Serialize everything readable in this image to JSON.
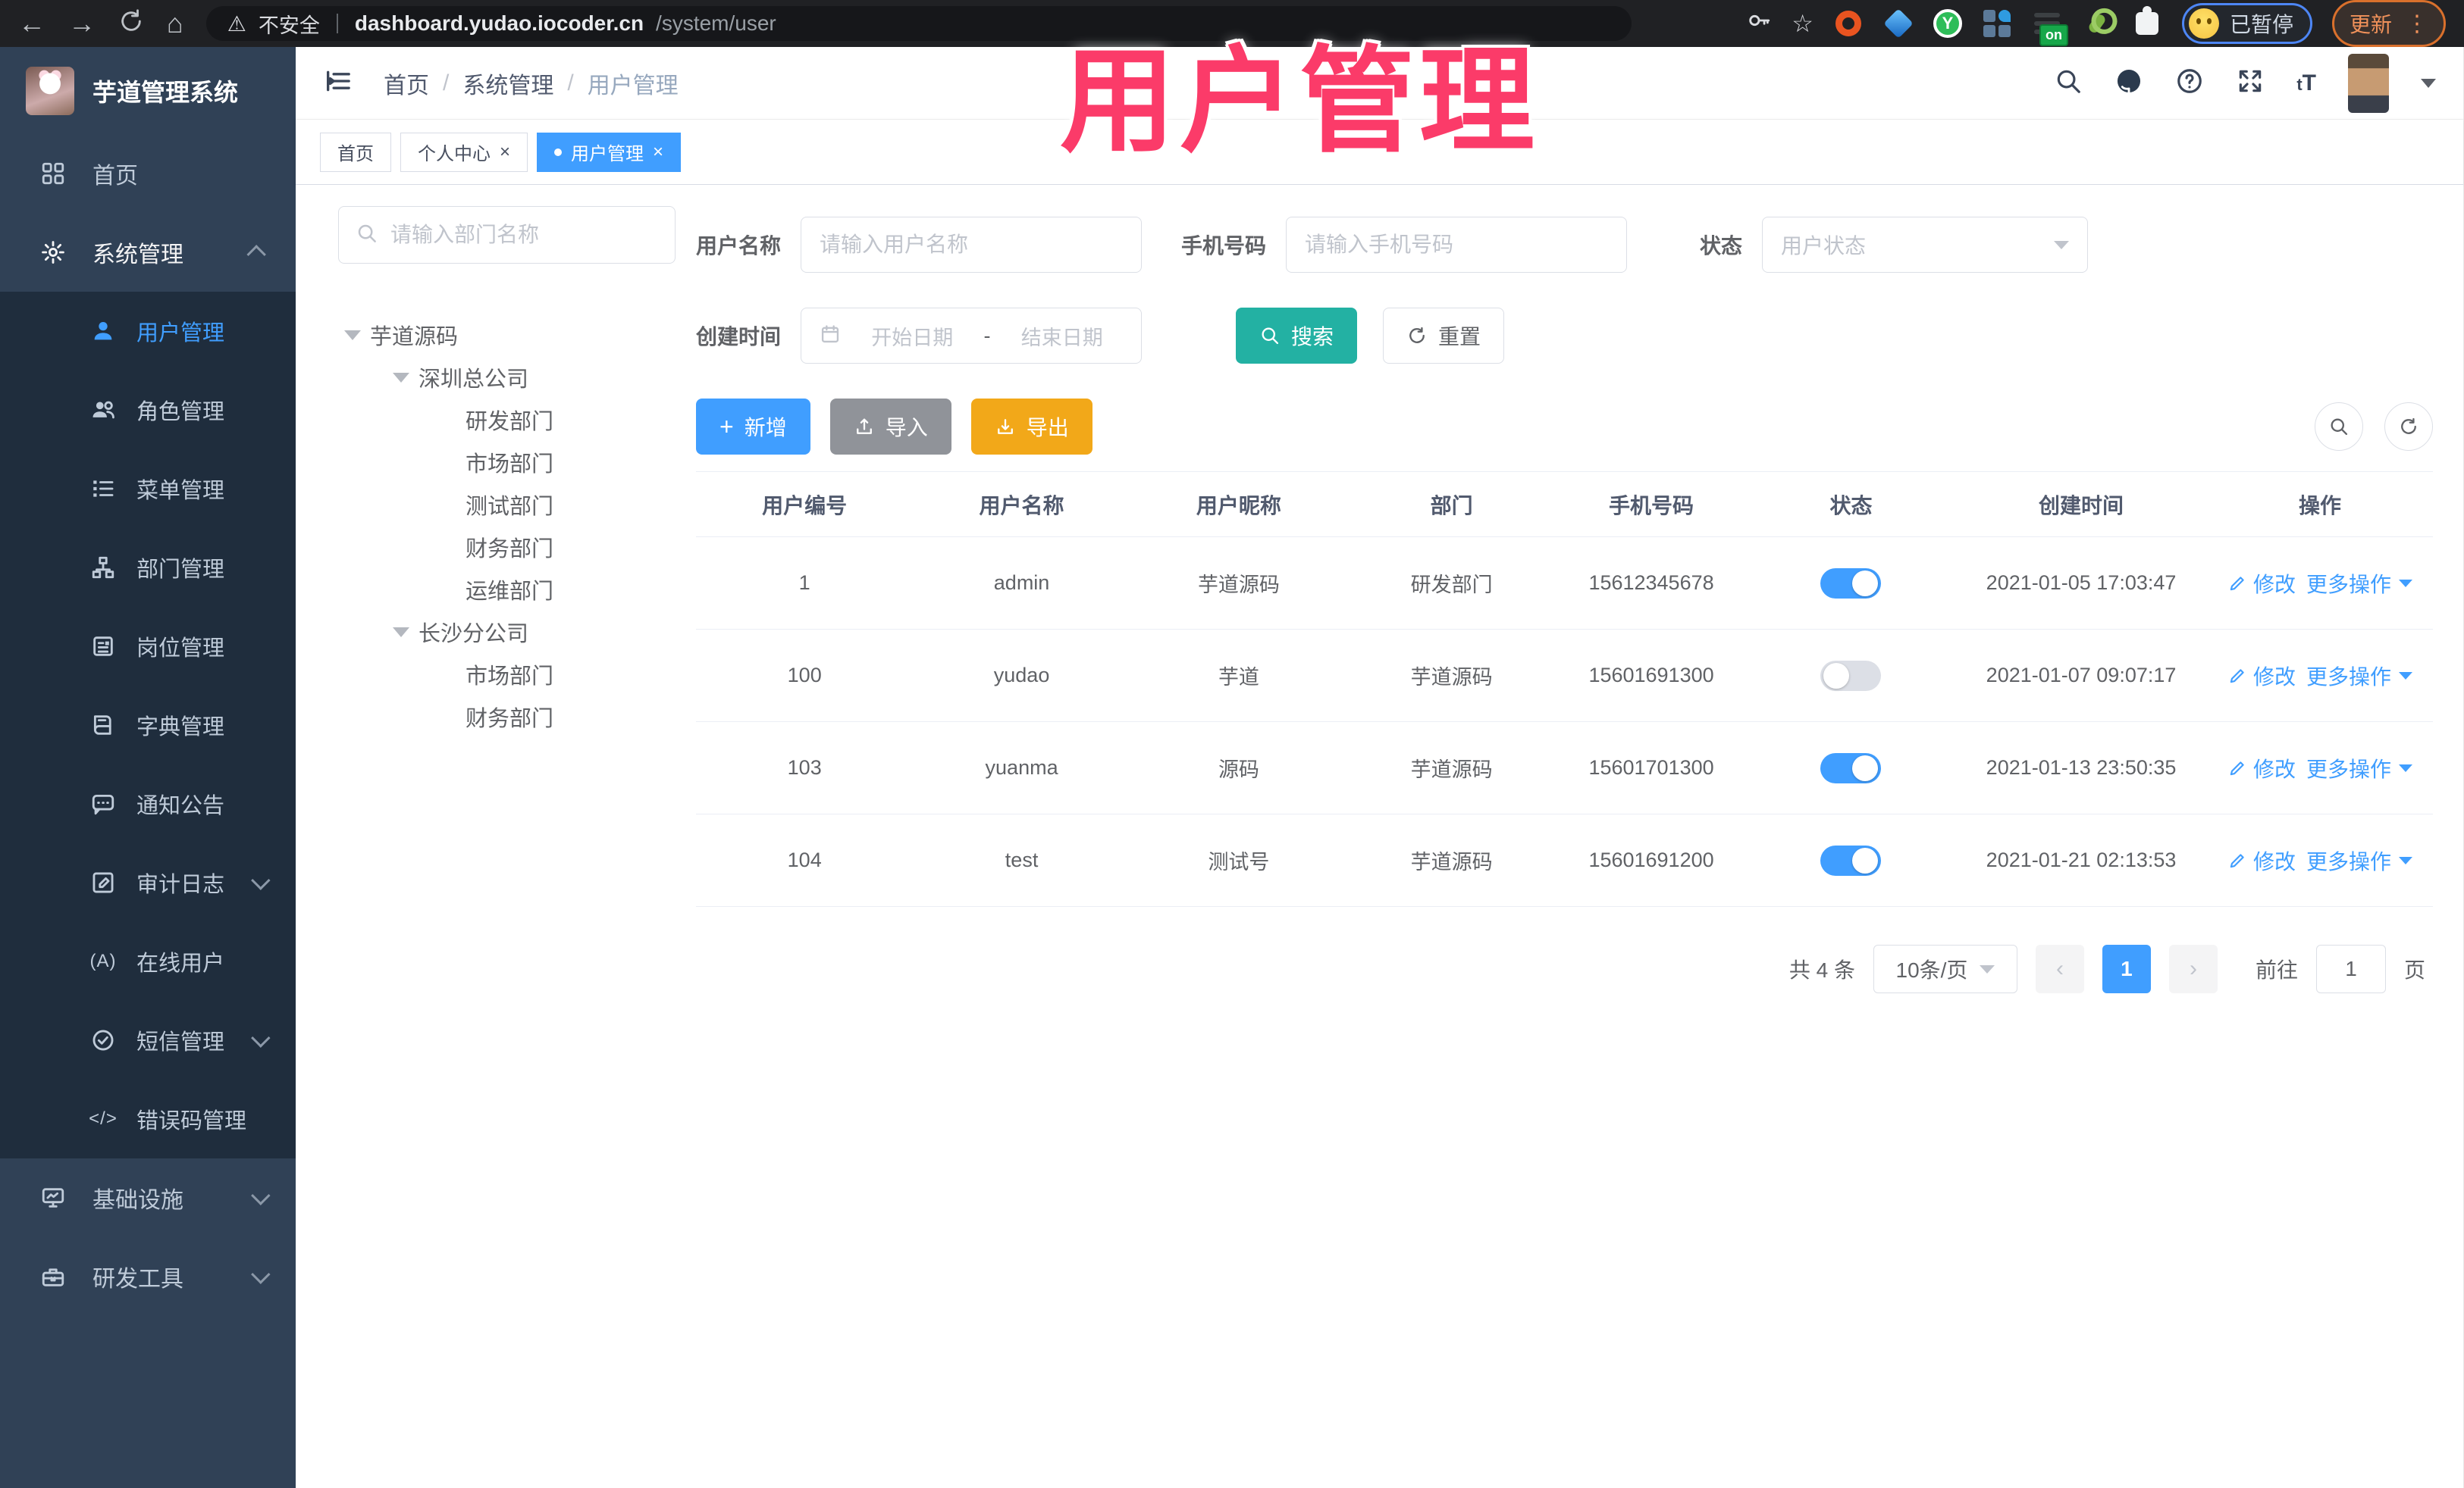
{
  "browser": {
    "back": "←",
    "forward": "→",
    "home": "⌂",
    "warning": "⚠",
    "security": "不安全",
    "url_host": "dashboard.yudao.iocoder.cn",
    "url_path": "/system/user",
    "star": "☆",
    "profile_status": "已暂停",
    "update_label": "更新",
    "kebab": "⋮",
    "ext_on_badge": "on",
    "ext_y_letter": "Y"
  },
  "overlay_title": "用户管理",
  "sidebar": {
    "app_title": "芋道管理系统",
    "home": "首页",
    "system": "系统管理",
    "submenu": [
      "用户管理",
      "角色管理",
      "菜单管理",
      "部门管理",
      "岗位管理",
      "字典管理",
      "通知公告",
      "审计日志",
      "在线用户",
      "短信管理",
      "错误码管理"
    ],
    "online_icon": "(A)",
    "code_icon": "</>",
    "infra": "基础设施",
    "devtools": "研发工具"
  },
  "header": {
    "breadcrumb": [
      "首页",
      "系统管理",
      "用户管理"
    ],
    "separator": "/",
    "question_mark": "?",
    "font_small": "t",
    "font_big": "T"
  },
  "tabs": {
    "items": [
      "首页",
      "个人中心",
      "用户管理"
    ],
    "close": "×"
  },
  "tree": {
    "search_placeholder": "请输入部门名称",
    "nodes": [
      {
        "label": "芋道源码"
      },
      {
        "label": "深圳总公司"
      },
      {
        "label": "研发部门"
      },
      {
        "label": "市场部门"
      },
      {
        "label": "测试部门"
      },
      {
        "label": "财务部门"
      },
      {
        "label": "运维部门"
      },
      {
        "label": "长沙分公司"
      },
      {
        "label": "市场部门"
      },
      {
        "label": "财务部门"
      }
    ]
  },
  "filters": {
    "username_label": "用户名称",
    "username_placeholder": "请输入用户名称",
    "mobile_label": "手机号码",
    "mobile_placeholder": "请输入手机号码",
    "status_label": "状态",
    "status_placeholder": "用户状态",
    "create_time_label": "创建时间",
    "date_start_placeholder": "开始日期",
    "date_separator": "-",
    "date_end_placeholder": "结束日期",
    "search_label": "搜索",
    "reset_label": "重置"
  },
  "toolbar": {
    "add_label": "新增",
    "add_plus": "+",
    "import_label": "导入",
    "export_label": "导出"
  },
  "table": {
    "columns": [
      "用户编号",
      "用户名称",
      "用户昵称",
      "部门",
      "手机号码",
      "状态",
      "创建时间",
      "操作"
    ],
    "edit_label": "修改",
    "more_label": "更多操作",
    "rows": [
      {
        "id": "1",
        "username": "admin",
        "nickname": "芋道源码",
        "dept": "研发部门",
        "mobile": "15612345678",
        "status_on": true,
        "created": "2021-01-05 17:03:47"
      },
      {
        "id": "100",
        "username": "yudao",
        "nickname": "芋道",
        "dept": "芋道源码",
        "mobile": "15601691300",
        "status_on": false,
        "created": "2021-01-07 09:07:17"
      },
      {
        "id": "103",
        "username": "yuanma",
        "nickname": "源码",
        "dept": "芋道源码",
        "mobile": "15601701300",
        "status_on": true,
        "created": "2021-01-13 23:50:35"
      },
      {
        "id": "104",
        "username": "test",
        "nickname": "测试号",
        "dept": "芋道源码",
        "mobile": "15601691200",
        "status_on": true,
        "created": "2021-01-21 02:13:53"
      }
    ]
  },
  "pagination": {
    "total": "共 4 条",
    "page_size": "10条/页",
    "prev": "‹",
    "next": "›",
    "current_page": "1",
    "goto_label": "前往",
    "goto_value": "1",
    "page_unit": "页"
  },
  "colors": {
    "accent_blue": "#409eff",
    "search_teal": "#23b1a3",
    "export_orange": "#f2a819",
    "import_gray": "#909399",
    "overlay_pink": "#fb3b69",
    "sidebar_bg": "#304156",
    "submenu_bg": "#1f2d3d"
  }
}
